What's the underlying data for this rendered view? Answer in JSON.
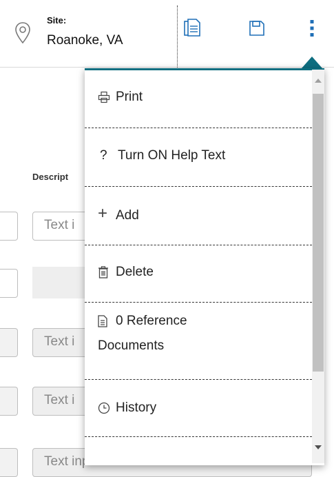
{
  "header": {
    "site_label": "Site:",
    "site_value": "Roanoke, VA",
    "icons": {
      "site": "location-pin-icon",
      "documents": "documents-icon",
      "save": "save-icon",
      "more": "more-vertical-icon"
    },
    "accent_color": "#1f6fb7"
  },
  "form": {
    "column_label": "Descript",
    "input_placeholder": "Text i",
    "last_input_placeholder": "Text input"
  },
  "menu": {
    "border_color": "#0e6e80",
    "items": [
      {
        "label": "Print",
        "icon": "print-icon"
      },
      {
        "label": "Turn ON Help Text",
        "icon": "help-icon",
        "glyph": "?"
      },
      {
        "label": "Add",
        "icon": "plus-icon",
        "glyph": "+"
      },
      {
        "label": "Delete",
        "icon": "trash-icon"
      },
      {
        "label_line1": "0 Reference",
        "label_line2": "Documents",
        "icon": "document-icon"
      },
      {
        "label": "History",
        "icon": "clock-icon"
      }
    ]
  }
}
